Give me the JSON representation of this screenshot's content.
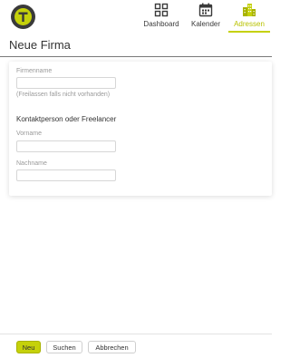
{
  "header": {
    "logo_letter": "T",
    "nav": [
      {
        "label": "Dashboard",
        "icon": "dashboard-grid-icon"
      },
      {
        "label": "Kalender",
        "icon": "calendar-icon"
      },
      {
        "label": "Adressen",
        "icon": "buildings-icon",
        "active": true
      }
    ]
  },
  "page": {
    "title": "Neue Firma"
  },
  "form": {
    "firmenname_label": "Firmenname",
    "firmenname_value": "",
    "firmenname_hint": "(Freilassen falls nicht vorhanden)",
    "contact_heading": "Kontaktperson oder Freelancer",
    "vorname_label": "Vorname",
    "vorname_value": "",
    "nachname_label": "Nachname",
    "nachname_value": ""
  },
  "footer": {
    "neu_label": "Neu",
    "suchen_label": "Suchen",
    "abbrechen_label": "Abbrechen"
  },
  "colors": {
    "accent": "#c5d10a",
    "active_nav_text": "#b8c200",
    "logo_bg": "#3a3a3a",
    "text": "#333333",
    "muted_text": "#9a9a9a"
  }
}
